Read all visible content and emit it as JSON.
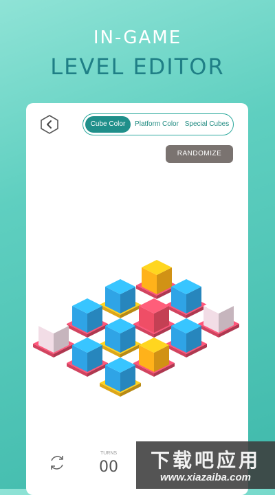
{
  "promo": {
    "line1": "IN-GAME",
    "line2": "LEVEL EDITOR"
  },
  "tabs": [
    {
      "label": "Cube Color",
      "active": true
    },
    {
      "label": "Platform Color",
      "active": false
    },
    {
      "label": "Special Cubes",
      "active": false
    }
  ],
  "randomize_label": "RANDOMIZE",
  "turns": {
    "label": "TURNS",
    "value": "00"
  },
  "watermark": {
    "title": "下载吧应用",
    "url": "www.xiazaiba.com"
  },
  "colors": {
    "teal_accent": "#1f8f8a",
    "blue_cube": "#2fa4e6",
    "orange_cube": "#ffb21a",
    "red_cube": "#ef4e66",
    "pink_platform": "#e84a6a",
    "yellow_platform": "#f5b81c",
    "special_cube": "#f2dde6"
  }
}
